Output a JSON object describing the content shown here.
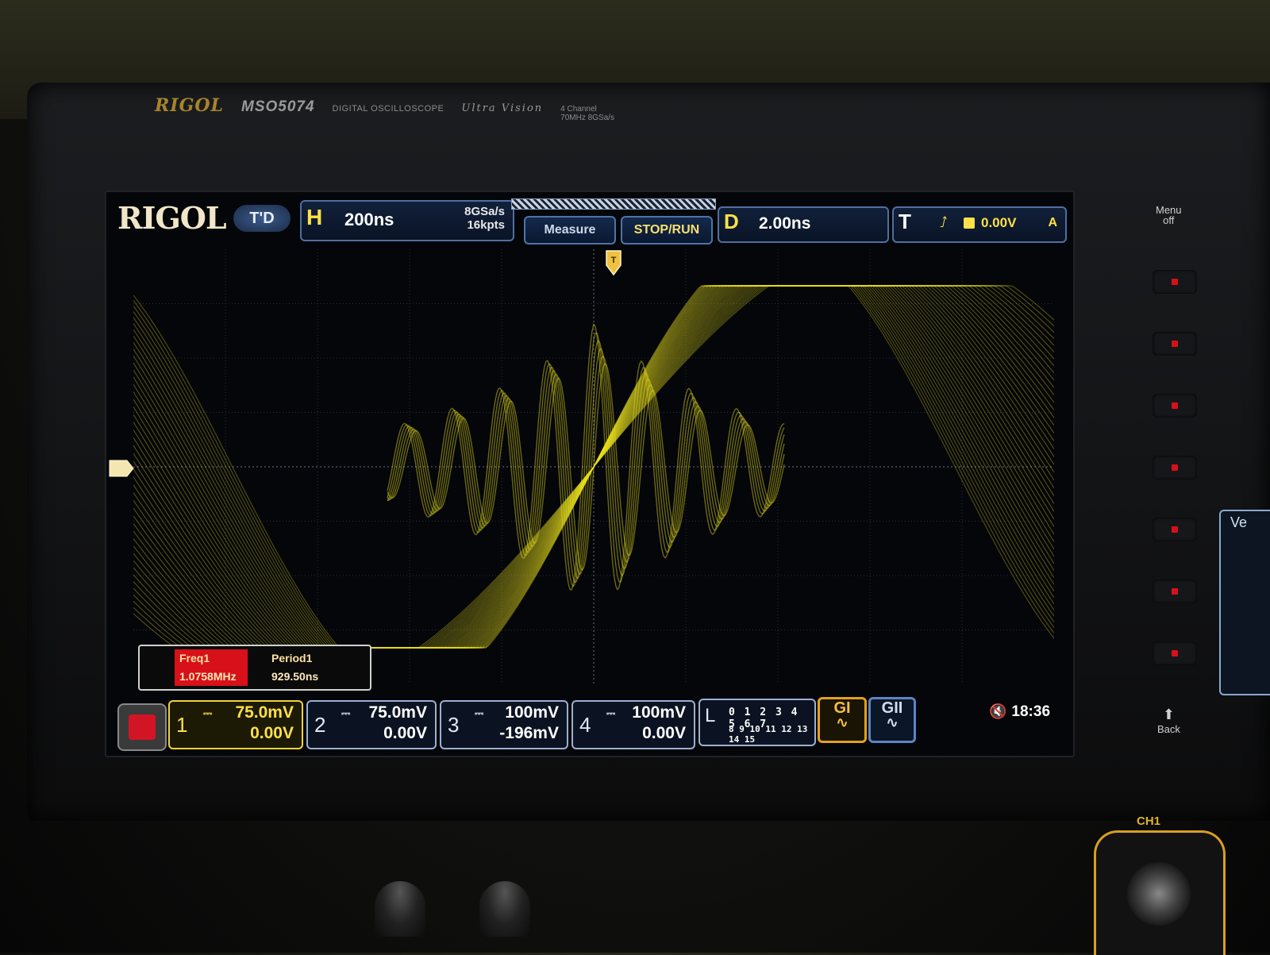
{
  "device": {
    "brand": "RIGOL",
    "model": "MSO5074",
    "description": "DIGITAL OSCILLOSCOPE",
    "series": "Ultra Vision",
    "spec_line1": "4 Channel",
    "spec_line2": "70MHz 8GSa/s"
  },
  "screen": {
    "logo": "RIGOL",
    "mode_badge": "T'D",
    "horizontal": {
      "key": "H",
      "timebase": "200ns",
      "sample_rate": "8GSa/s",
      "memory_depth": "16kpts"
    },
    "buttons": {
      "measure": "Measure",
      "stop_run": "STOP/RUN"
    },
    "delay": {
      "key": "D",
      "value": "2.00ns"
    },
    "trigger": {
      "key": "T",
      "edge_icon": "rising-edge-icon",
      "level": "0.00V",
      "mode": "A"
    },
    "measurements": [
      {
        "label": "Freq1",
        "value": "1.0758MHz"
      },
      {
        "label": "Period1",
        "value": "929.50ns"
      }
    ],
    "channels": [
      {
        "num": "1",
        "scale": "75.0mV",
        "offset": "0.00V",
        "active": true
      },
      {
        "num": "2",
        "scale": "75.0mV",
        "offset": "0.00V",
        "active": false
      },
      {
        "num": "3",
        "scale": "100mV",
        "offset": "-196mV",
        "active": false
      },
      {
        "num": "4",
        "scale": "100mV",
        "offset": "0.00V",
        "active": false
      }
    ],
    "logic": {
      "key": "L",
      "row1": "0 1 2 3  4 5 6 7",
      "row2": "8 9 10 11 12 13 14 15"
    },
    "generators": {
      "g1": "GI",
      "g2": "GII"
    },
    "clock": "18:36"
  },
  "side_panel": {
    "menu_off_line1": "Menu",
    "menu_off_line2": "off",
    "back": "Back",
    "ch1_connector": "CH1",
    "clipped_label": "Ve"
  },
  "colors": {
    "trace": "#e8e020",
    "accent_yellow": "#ffe048",
    "frame_blue": "#4f6f9e",
    "stop_red": "#d21525"
  }
}
